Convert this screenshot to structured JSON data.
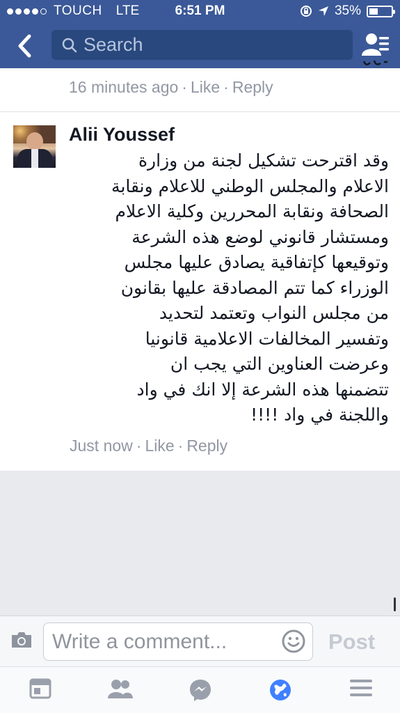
{
  "status_bar": {
    "carrier": "TOUCH",
    "network": "LTE",
    "time": "6:51 PM",
    "battery": "35%",
    "battery_level": 0.35
  },
  "header": {
    "search_placeholder": "Search"
  },
  "prev_comment": {
    "time": "16 minutes ago",
    "like_label": "Like",
    "reply_label": "Reply"
  },
  "comment": {
    "author": "Alii Youssef",
    "lines": [
      "وقد اقترحت تشكيل لجنة من وزارة",
      "الاعلام والمجلس الوطني للاعلام ونقابة",
      "الصحافة ونقابة المحررين وكلية الاعلام",
      "ومستشار قانوني لوضع هذه الشرعة",
      "وتوقيعها كإتفاقية يصادق عليها مجلس",
      "الوزراء كما تتم المصادقة عليها بقانون",
      "من مجلس النواب وتعتمد لتحديد",
      "وتفسير المخالفات الاعلامية قانونيا",
      "وعرضت العناوين التي يجب ان",
      "تتضمنها هذه الشرعة إلا انك في واد",
      "واللجنة في واد !!!!"
    ],
    "time": "Just now",
    "like_label": "Like",
    "reply_label": "Reply"
  },
  "composer": {
    "placeholder": "Write a comment...",
    "post_label": "Post"
  },
  "tabs": [
    {
      "icon": "news-feed-icon"
    },
    {
      "icon": "friends-icon"
    },
    {
      "icon": "messenger-icon"
    },
    {
      "icon": "globe-notifications-icon"
    },
    {
      "icon": "menu-icon"
    }
  ],
  "colors": {
    "header": "#3b5998",
    "search_box": "#29487d",
    "active_tab": "#4080ff",
    "meta_text": "#9197a3"
  }
}
